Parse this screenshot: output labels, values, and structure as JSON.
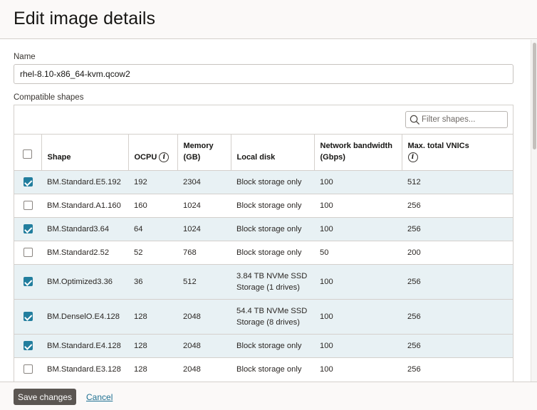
{
  "dialog": {
    "title": "Edit image details"
  },
  "form": {
    "name_label": "Name",
    "name_value": "rhel-8.10-x86_64-kvm.qcow2",
    "shapes_label": "Compatible shapes",
    "filter_placeholder": "Filter shapes..."
  },
  "table": {
    "headers": {
      "shape": "Shape",
      "ocpu": "OCPU",
      "memory_l1": "Memory",
      "memory_l2": "(GB)",
      "local_disk": "Local disk",
      "bandwidth_l1": "Network bandwidth",
      "bandwidth_l2": "(Gbps)",
      "vnics": "Max. total VNICs"
    },
    "rows": [
      {
        "checked": true,
        "shape": "BM.Standard.E5.192",
        "ocpu": "192",
        "memory": "2304",
        "disk_l1": "Block storage only",
        "disk_l2": "",
        "bandwidth": "100",
        "vnics": "512"
      },
      {
        "checked": false,
        "shape": "BM.Standard.A1.160",
        "ocpu": "160",
        "memory": "1024",
        "disk_l1": "Block storage only",
        "disk_l2": "",
        "bandwidth": "100",
        "vnics": "256"
      },
      {
        "checked": true,
        "shape": "BM.Standard3.64",
        "ocpu": "64",
        "memory": "1024",
        "disk_l1": "Block storage only",
        "disk_l2": "",
        "bandwidth": "100",
        "vnics": "256"
      },
      {
        "checked": false,
        "shape": "BM.Standard2.52",
        "ocpu": "52",
        "memory": "768",
        "disk_l1": "Block storage only",
        "disk_l2": "",
        "bandwidth": "50",
        "vnics": "200"
      },
      {
        "checked": true,
        "shape": "BM.Optimized3.36",
        "ocpu": "36",
        "memory": "512",
        "disk_l1": "3.84 TB NVMe SSD",
        "disk_l2": "Storage (1 drives)",
        "bandwidth": "100",
        "vnics": "256"
      },
      {
        "checked": true,
        "shape": "BM.DenselO.E4.128",
        "ocpu": "128",
        "memory": "2048",
        "disk_l1": "54.4 TB NVMe SSD",
        "disk_l2": "Storage (8 drives)",
        "bandwidth": "100",
        "vnics": "256"
      },
      {
        "checked": true,
        "shape": "BM.Standard.E4.128",
        "ocpu": "128",
        "memory": "2048",
        "disk_l1": "Block storage only",
        "disk_l2": "",
        "bandwidth": "100",
        "vnics": "256"
      },
      {
        "checked": false,
        "shape": "BM.Standard.E3.128",
        "ocpu": "128",
        "memory": "2048",
        "disk_l1": "Block storage only",
        "disk_l2": "",
        "bandwidth": "100",
        "vnics": "256"
      }
    ]
  },
  "footer": {
    "save_label": "Save changes",
    "cancel_label": "Cancel"
  },
  "colors": {
    "accent": "#227e9e",
    "selected_row": "#e8f1f4",
    "save_button": "#5b5652",
    "link": "#1d6f91"
  }
}
